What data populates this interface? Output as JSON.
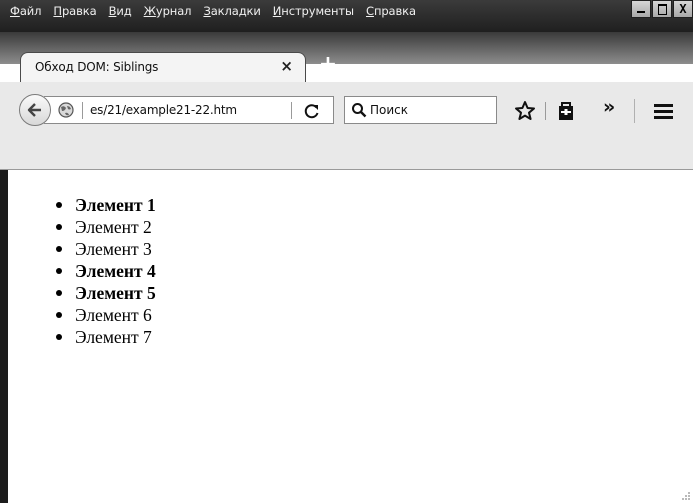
{
  "menu": {
    "items": [
      {
        "prefix": "",
        "accel": "Ф",
        "rest": "айл"
      },
      {
        "prefix": "",
        "accel": "П",
        "rest": "равка"
      },
      {
        "prefix": "",
        "accel": "В",
        "rest": "ид"
      },
      {
        "prefix": "",
        "accel": "Ж",
        "rest": "урнал"
      },
      {
        "prefix": "",
        "accel": "З",
        "rest": "акладки"
      },
      {
        "prefix": "",
        "accel": "И",
        "rest": "нструменты"
      },
      {
        "prefix": "",
        "accel": "С",
        "rest": "правка"
      }
    ]
  },
  "window_controls": {
    "close": "X"
  },
  "tab": {
    "title": "Обход DOM: Siblings",
    "close": "×",
    "new_tab": "+"
  },
  "toolbar": {
    "url": "es/21/example21-22.htm",
    "search_placeholder": "Поиск",
    "overflow": "»"
  },
  "content": {
    "list": [
      {
        "text": "Элемент 1",
        "bold": true
      },
      {
        "text": "Элемент 2",
        "bold": false
      },
      {
        "text": "Элемент 3",
        "bold": false
      },
      {
        "text": "Элемент 4",
        "bold": true
      },
      {
        "text": "Элемент 5",
        "bold": true
      },
      {
        "text": "Элемент 6",
        "bold": false
      },
      {
        "text": "Элемент 7",
        "bold": false
      }
    ]
  },
  "icons": {
    "back": "back-arrow-icon",
    "site": "globe-icon",
    "reload": "reload-icon",
    "search": "search-icon",
    "bookmark": "star-icon",
    "library": "library-icon",
    "menu": "hamburger-icon"
  }
}
